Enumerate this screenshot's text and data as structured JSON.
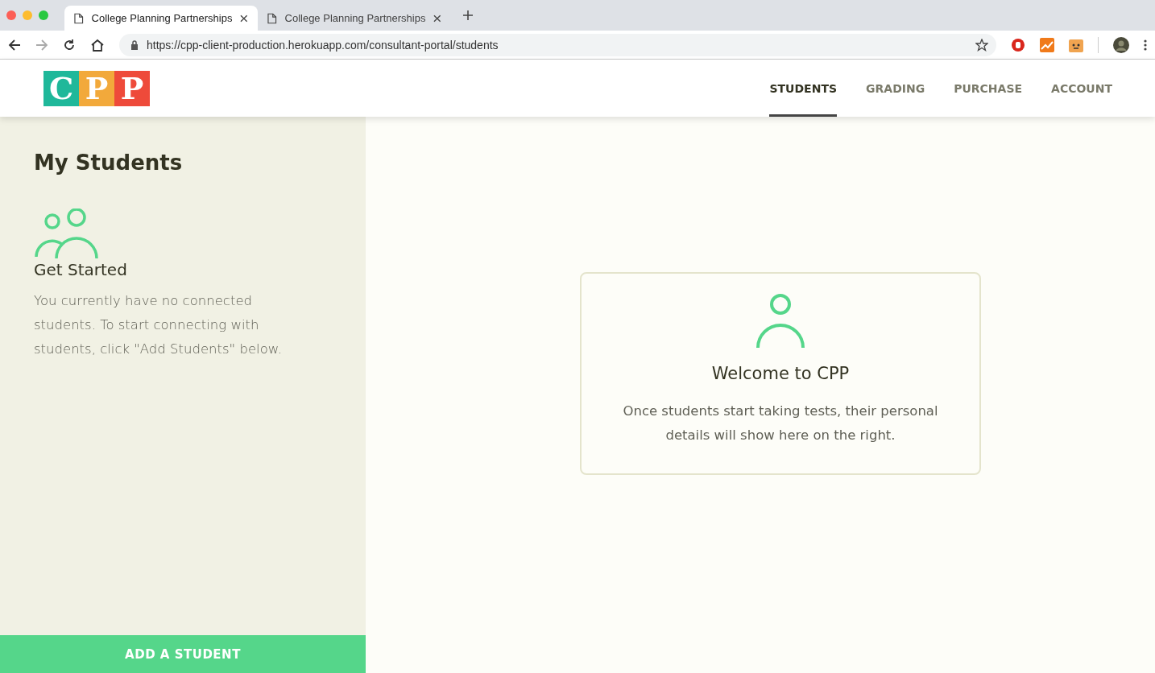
{
  "browser": {
    "tabs": [
      {
        "title": "College Planning Partnerships",
        "selected": true
      },
      {
        "title": "College Planning Partnerships",
        "selected": false
      }
    ],
    "url": "https://cpp-client-production.herokuapp.com/consultant-portal/students"
  },
  "header": {
    "logo_letters": [
      {
        "letter": "C",
        "color": "#1fb89a"
      },
      {
        "letter": "P",
        "color": "#f2a93b"
      },
      {
        "letter": "P",
        "color": "#ee4a3a"
      }
    ],
    "nav": [
      {
        "label": "STUDENTS",
        "selected": true
      },
      {
        "label": "GRADING",
        "selected": false
      },
      {
        "label": "PURCHASE",
        "selected": false
      },
      {
        "label": "ACCOUNT",
        "selected": false
      }
    ]
  },
  "sidebar": {
    "title": "My Students",
    "subtitle": "Get Started",
    "text": "You currently have no connected students. To start connecting with students, click \"Add Students\" below.",
    "button": "ADD A STUDENT"
  },
  "main": {
    "card": {
      "title": "Welcome to CPP",
      "text": "Once students start taking tests, their personal details will show here on the right."
    }
  }
}
